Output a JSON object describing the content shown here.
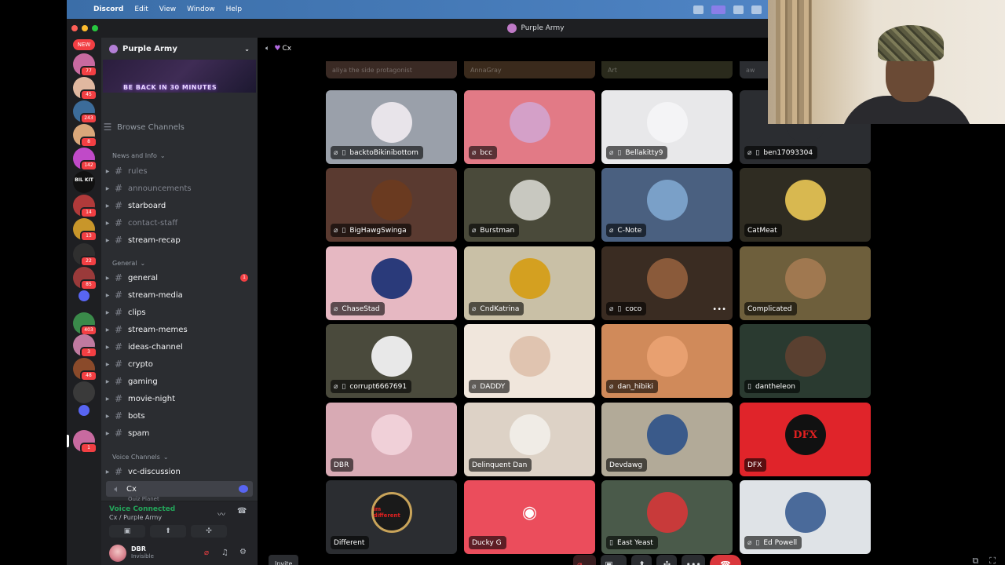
{
  "menubar": {
    "app": "Discord",
    "items": [
      "Edit",
      "View",
      "Window",
      "Help"
    ]
  },
  "window": {
    "title": "Purple Army"
  },
  "rail": {
    "new_badge": "NEW",
    "servers": [
      {
        "badge": "77",
        "color": "#c86aa0"
      },
      {
        "badge": "45",
        "color": "#e0b8a0"
      },
      {
        "badge": "243",
        "color": "#3c6c9a"
      },
      {
        "badge": "8",
        "color": "#d9a77a"
      },
      {
        "badge": "142",
        "color": "#c04ac8"
      },
      {
        "badge": "",
        "color": "#111111",
        "text": "BIL KIT"
      },
      {
        "badge": "14",
        "color": "#b03a3a"
      },
      {
        "badge": "13",
        "color": "#c8962a"
      },
      {
        "badge": "22",
        "color": "#2f2f2f"
      },
      {
        "badge": "85",
        "color": "#9a3a3a"
      },
      {
        "badge": "",
        "color": "#5865f2"
      },
      {
        "badge": "403",
        "color": "#3a8a4a"
      },
      {
        "badge": "3",
        "color": "#c07aa0"
      },
      {
        "badge": "48",
        "color": "#8a4a2a"
      },
      {
        "badge": "",
        "color": "#3a3a3a"
      },
      {
        "badge": "",
        "color": "#5865f2"
      },
      {
        "badge": "1",
        "color": "#c86aa0"
      }
    ]
  },
  "sidebar": {
    "guild_name": "Purple Army",
    "banner_text": "BE BACK IN 30 MINUTES",
    "browse": "Browse Channels",
    "categories": [
      {
        "label": "News and Info",
        "channels": [
          {
            "name": "rules",
            "style": "dim"
          },
          {
            "name": "announcements",
            "style": "dim"
          },
          {
            "name": "starboard",
            "style": "bright"
          },
          {
            "name": "contact-staff",
            "style": "dim"
          },
          {
            "name": "stream-recap",
            "style": "bright"
          }
        ]
      },
      {
        "label": "General",
        "channels": [
          {
            "name": "general",
            "style": "bright",
            "mention": "1"
          },
          {
            "name": "stream-media",
            "style": "bright"
          },
          {
            "name": "clips",
            "style": "bright"
          },
          {
            "name": "stream-memes",
            "style": "bright"
          },
          {
            "name": "ideas-channel",
            "style": "bright"
          },
          {
            "name": "crypto",
            "style": "bright"
          },
          {
            "name": "gaming",
            "style": "bright"
          },
          {
            "name": "movie-night",
            "style": "bright"
          },
          {
            "name": "bots",
            "style": "bright"
          },
          {
            "name": "spam",
            "style": "bright"
          }
        ]
      },
      {
        "label": "Voice Channels",
        "channels": [
          {
            "name": "vc-discussion",
            "style": "bright"
          },
          {
            "name": "Cx",
            "style": "selected"
          }
        ]
      }
    ],
    "sub_under_cx": "Quiz Planet"
  },
  "voice": {
    "status": "Voice Connected",
    "location": "Cx / Purple Army"
  },
  "user": {
    "name": "DBR",
    "status": "Invisible"
  },
  "stage": {
    "channel": "Cx",
    "invite": "Invite",
    "ghost_tiles": [
      "aliya the side protagonist",
      "AnnaGray",
      "Art",
      "aw"
    ],
    "tiles": [
      {
        "name": "backtoBikinibottom",
        "bg": "#9aa0aa",
        "av": "#e8e4ea",
        "muted": true,
        "phone": true
      },
      {
        "name": "bcc",
        "bg": "#e27a86",
        "av": "#d4a0c8",
        "muted": true,
        "phone": false
      },
      {
        "name": "Bellakitty9",
        "bg": "#e8e8ea",
        "av": "#f4f4f6",
        "muted": true,
        "phone": true
      },
      {
        "name": "ben17093304",
        "bg": "#2b2d31",
        "av": "#2b2d31",
        "muted": true,
        "phone": true
      },
      {
        "name": "BigHawgSwinga",
        "bg": "#5a3a30",
        "av": "#6a3a20",
        "muted": true,
        "phone": true
      },
      {
        "name": "Burstman",
        "bg": "#4a4a3a",
        "av": "#c8c8c0",
        "muted": true,
        "phone": false
      },
      {
        "name": "C-Note",
        "bg": "#4a6080",
        "av": "#7aa0c8",
        "muted": true,
        "phone": false
      },
      {
        "name": "CatMeat",
        "bg": "#2f2c22",
        "av": "#d8b850",
        "muted": false,
        "phone": false
      },
      {
        "name": "ChaseStad",
        "bg": "#e6b8c2",
        "av": "#2a3a7a",
        "muted": true,
        "phone": false
      },
      {
        "name": "CndKatrina",
        "bg": "#c9c0a6",
        "av": "#d4a020",
        "muted": true,
        "phone": false
      },
      {
        "name": "coco",
        "bg": "#3a2c22",
        "av": "#8a5a3a",
        "muted": true,
        "phone": true,
        "more": true
      },
      {
        "name": "Complicated",
        "bg": "#6e5f3c",
        "av": "#a07850",
        "muted": false,
        "phone": false
      },
      {
        "name": "corrupt6667691",
        "bg": "#4a4a3c",
        "av": "#e8e8e8",
        "muted": true,
        "phone": true
      },
      {
        "name": "DADDY",
        "bg": "#f0e6dc",
        "av": "#e0c4b0",
        "muted": true,
        "phone": false
      },
      {
        "name": "dan_hibiki",
        "bg": "#d08a5a",
        "av": "#e8a070",
        "muted": true,
        "phone": false
      },
      {
        "name": "dantheleon",
        "bg": "#2a3a30",
        "av": "#5a4030",
        "muted": false,
        "phone": true
      },
      {
        "name": "DBR",
        "bg": "#d8aab4",
        "av": "#f0d0d8",
        "muted": false,
        "phone": false
      },
      {
        "name": "Delinquent Dan",
        "bg": "#ddd2c6",
        "av": "#f0ece6",
        "muted": false,
        "phone": false
      },
      {
        "name": "Devdawg",
        "bg": "#b2aa98",
        "av": "#3a5a8a",
        "muted": false,
        "phone": false
      },
      {
        "name": "DFX",
        "bg": "#e0242a",
        "av": "#1a1a1a",
        "muted": false,
        "phone": false
      },
      {
        "name": "Different",
        "bg": "#2b2d31",
        "av": "#2b2d31",
        "muted": false,
        "phone": false
      },
      {
        "name": "Ducky G",
        "bg": "#eb4d5c",
        "av": "#eb4d5c",
        "muted": false,
        "phone": false
      },
      {
        "name": "East Yeast",
        "bg": "#4a5a4a",
        "av": "#c83a3a",
        "muted": false,
        "phone": true
      },
      {
        "name": "Ed Powell",
        "bg": "#dfe3e7",
        "av": "#4a6a9a",
        "muted": true,
        "phone": true
      }
    ],
    "avatar_caption_different": "im different"
  }
}
